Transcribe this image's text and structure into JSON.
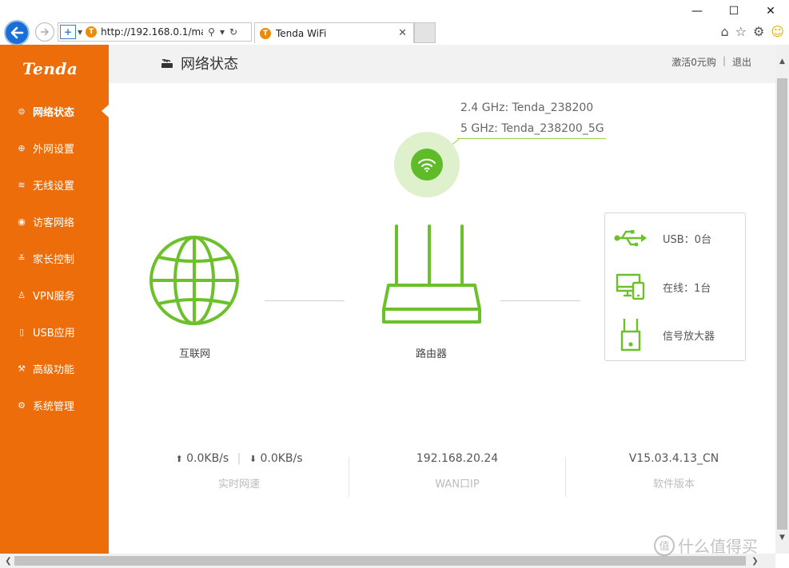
{
  "browser": {
    "url": "http://192.168.0.1/mai",
    "tab_title": "Tenda WiFi",
    "favicon_letter": "T",
    "window_minimize": "—",
    "window_maximize": "☐",
    "window_close": "✕",
    "tab_close": "✕"
  },
  "sidebar": {
    "logo": "Tenda",
    "items": [
      {
        "label": "网络状态",
        "icon": "router-icon",
        "glyph": "⊜",
        "active": true
      },
      {
        "label": "外网设置",
        "icon": "globe-icon",
        "glyph": "⊕",
        "active": false
      },
      {
        "label": "无线设置",
        "icon": "wifi-icon",
        "glyph": "≋",
        "active": false
      },
      {
        "label": "访客网络",
        "icon": "guest-icon",
        "glyph": "◉",
        "active": false
      },
      {
        "label": "家长控制",
        "icon": "parental-icon",
        "glyph": "≚",
        "active": false
      },
      {
        "label": "VPN服务",
        "icon": "vpn-icon",
        "glyph": "♙",
        "active": false
      },
      {
        "label": "USB应用",
        "icon": "usb-icon",
        "glyph": "▯",
        "active": false
      },
      {
        "label": "高级功能",
        "icon": "wrench-icon",
        "glyph": "⚒",
        "active": false
      },
      {
        "label": "系统管理",
        "icon": "gear-icon",
        "glyph": "⚙",
        "active": false
      }
    ]
  },
  "header": {
    "title": "网络状态",
    "activate_link": "激活0元购",
    "separator": "|",
    "logout_link": "退出"
  },
  "wifi": {
    "ssid_24": "2.4 GHz: Tenda_238200",
    "ssid_5": "5 GHz: Tenda_238200_5G"
  },
  "topology": {
    "internet_label": "互联网",
    "router_label": "路由器"
  },
  "devices": {
    "usb": "USB：0台",
    "online": "在线：1台",
    "extender": "信号放大器"
  },
  "stats": {
    "upload": "0.0KB/s",
    "download": "0.0KB/s",
    "speed_label": "实时网速",
    "wan_ip": "192.168.20.24",
    "wan_label": "WAN口IP",
    "firmware": "V15.03.4.13_CN",
    "firmware_label": "软件版本"
  },
  "watermark": "什么值得买",
  "colors": {
    "accent_orange": "#ec6d0a",
    "accent_green": "#6cc12b"
  }
}
